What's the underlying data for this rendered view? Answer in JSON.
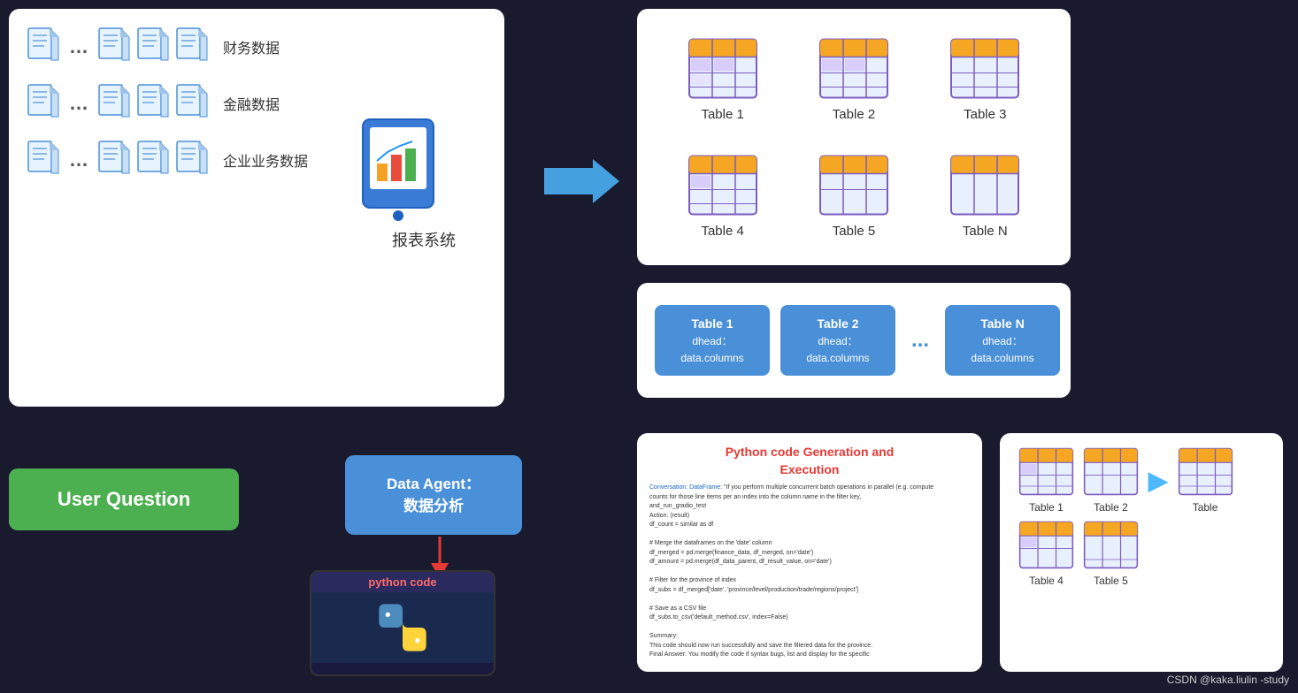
{
  "left_panel": {
    "groups": [
      {
        "label": "财务数据",
        "docs": 4
      },
      {
        "label": "金融数据",
        "docs": 4
      },
      {
        "label": "企业业务数据",
        "docs": 4
      }
    ],
    "system_label": "报表系统"
  },
  "top_right_tables": {
    "items": [
      {
        "label": "Table 1"
      },
      {
        "label": "Table 2"
      },
      {
        "label": "Table 3"
      },
      {
        "label": "Table 4"
      },
      {
        "label": "Table 5"
      },
      {
        "label": "Table N"
      }
    ]
  },
  "mid_right": {
    "items": [
      {
        "title": "Table 1",
        "sub": "dhead：\ndata.columns"
      },
      {
        "title": "Table 2",
        "sub": "dhead：\ndata.columns"
      },
      {
        "title": "Table N",
        "sub": "dhead：\ndata.columns"
      }
    ],
    "dots": "..."
  },
  "bottom_left": {
    "user_question": "User Question",
    "data_agent_line1": "Data Agent：",
    "data_agent_line2": "数据分析",
    "python_code_label": "python code"
  },
  "py_gen_panel": {
    "title": "Python code Generation and\nExecution",
    "content": "Conversation: DataFrame: \"If you perform multiple concurrent batch operations in parallel (e.g. compute\ncounts for those line items per an index into the column name in the filter key,\nand_run_gradio_test\nAction: (result)\ndf_count = similar as df\n\n# Merge the dataframes on the 'date' column\ndf_merged = pd.merge(finance_data, df_merged, on='date')\ndf_amount = pd.merge(df_data_parent, df_result_value, on='date')\n\n# Filter for the province of index\ndf_subs = df_merged['date', 'province/level/production/trade/regions/project']\n\n# Save as a CSV file\ndf_subs.to_csv('default_method.csv', index=False)\n\nSummary:\nThis code should now run successfully and save the filtered data for the province.\nFinal Answer: You modify the code if syntax bugs, list and display for the specific"
  },
  "result_panel": {
    "row1": [
      {
        "label": "Table 1"
      },
      {
        "label": "Table 2"
      }
    ],
    "arrow": "▶",
    "row2": [
      {
        "label": "Table 4"
      },
      {
        "label": "Table 5"
      }
    ],
    "result_label": "Table"
  },
  "watermark": "CSDN @kaka.liulin -study"
}
